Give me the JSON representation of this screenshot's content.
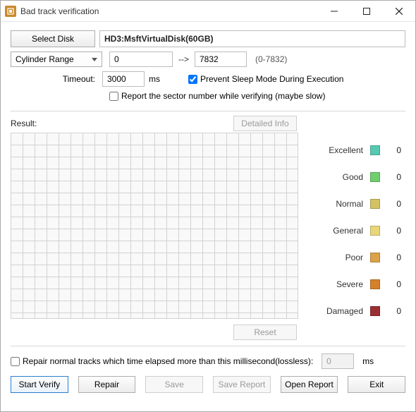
{
  "title": "Bad track verification",
  "selectDiskLabel": "Select Disk",
  "diskName": "HD3:MsftVirtualDisk(60GB)",
  "cylinderRangeLabel": "Cylinder Range",
  "rangeFrom": "0",
  "rangeArrow": "-->",
  "rangeTo": "7832",
  "rangeHint": "(0-7832)",
  "timeoutLabel": "Timeout:",
  "timeoutValue": "3000",
  "timeoutUnit": "ms",
  "preventSleepChecked": true,
  "preventSleepLabel": "Prevent Sleep Mode During Execution",
  "reportSectorChecked": false,
  "reportSectorLabel": "Report the sector number while verifying (maybe slow)",
  "resultLabel": "Result:",
  "detailedInfoLabel": "Detailed Info",
  "legend": [
    {
      "label": "Excellent",
      "color": "#56c9b3",
      "value": "0"
    },
    {
      "label": "Good",
      "color": "#6fcf6f",
      "value": "0"
    },
    {
      "label": "Normal",
      "color": "#d3c264",
      "value": "0"
    },
    {
      "label": "General",
      "color": "#e8d77a",
      "value": "0"
    },
    {
      "label": "Poor",
      "color": "#dba24a",
      "value": "0"
    },
    {
      "label": "Severe",
      "color": "#d5812a",
      "value": "0"
    },
    {
      "label": "Damaged",
      "color": "#9a2e34",
      "value": "0"
    }
  ],
  "resetLabel": "Reset",
  "repairNormalChecked": false,
  "repairNormalLabel": "Repair normal tracks which time elapsed more than this millisecond(lossless):",
  "repairNormalValue": "0",
  "repairNormalUnit": "ms",
  "buttons": {
    "startVerify": "Start Verify",
    "repair": "Repair",
    "save": "Save",
    "saveReport": "Save Report",
    "openReport": "Open Report",
    "exit": "Exit"
  }
}
